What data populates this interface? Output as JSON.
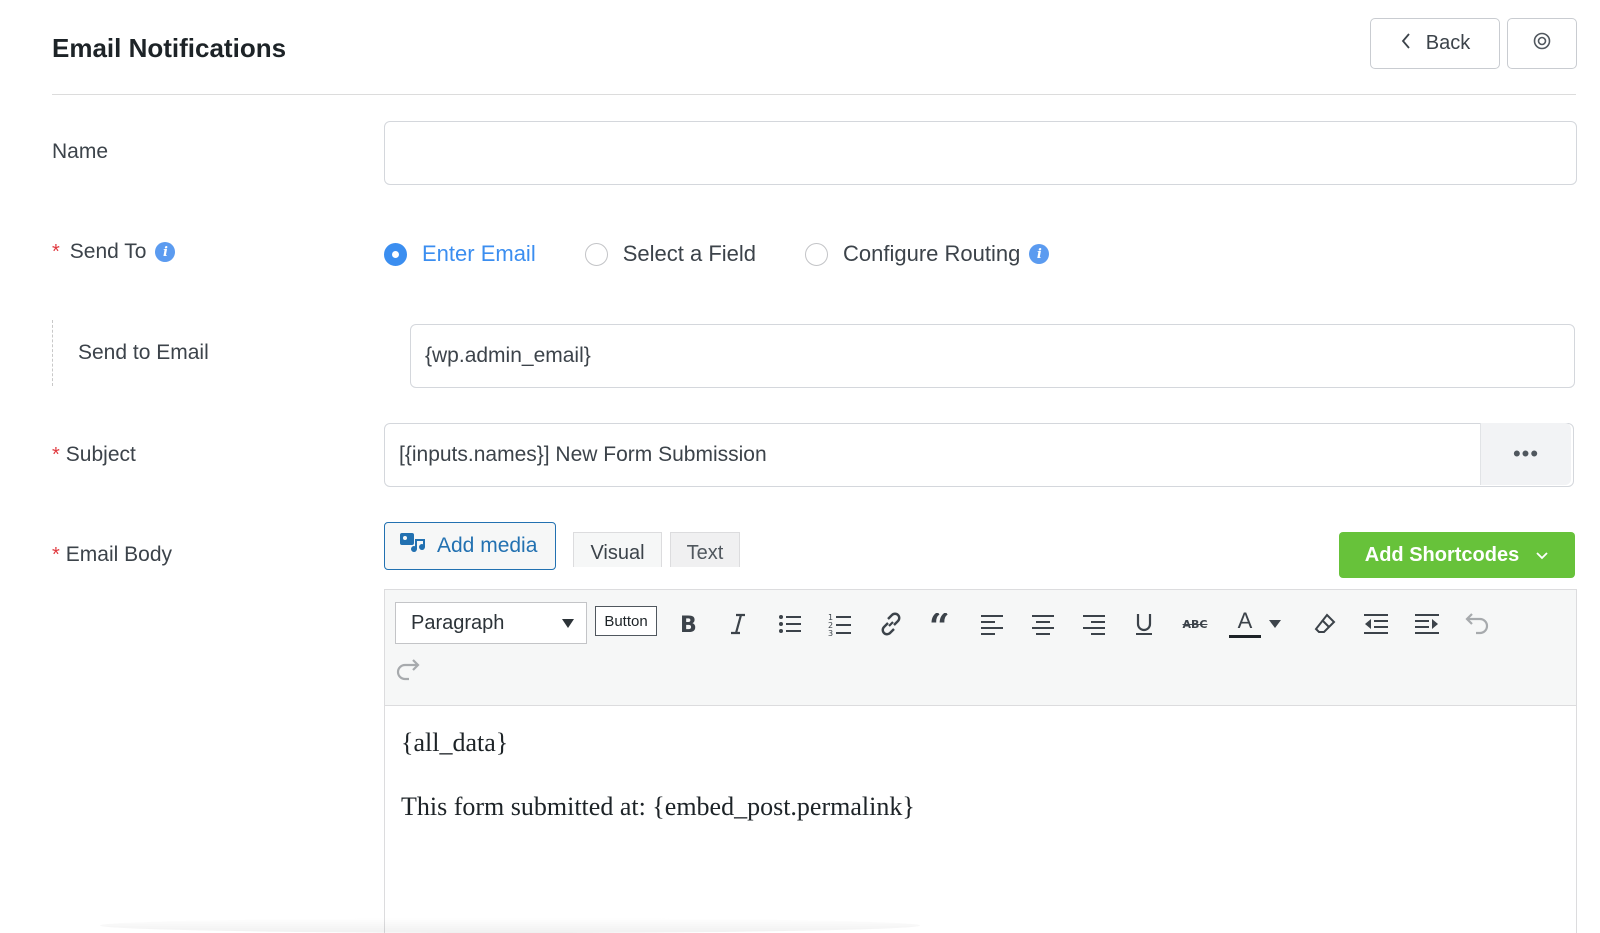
{
  "header": {
    "title": "Email Notifications",
    "back_label": "Back"
  },
  "name_field": {
    "label": "Name",
    "value": ""
  },
  "send_to": {
    "label": "Send To",
    "required_marker": "*",
    "options": [
      {
        "label": "Enter Email",
        "checked": true
      },
      {
        "label": "Select a Field",
        "checked": false
      },
      {
        "label": "Configure Routing",
        "checked": false
      }
    ]
  },
  "send_to_email": {
    "label": "Send to Email",
    "value": "{wp.admin_email}"
  },
  "subject": {
    "label": "Subject",
    "required_marker": "*",
    "value": "[{inputs.names}] New Form Submission",
    "more_label": "•••"
  },
  "email_body": {
    "label": "Email Body",
    "required_marker": "*",
    "add_media_label": "Add media",
    "tabs": [
      "Visual",
      "Text"
    ],
    "active_tab": "Visual",
    "add_shortcodes_label": "Add Shortcodes",
    "toolbar": {
      "format_value": "Paragraph",
      "button_label": "Button",
      "strikethrough_label": "ABC",
      "text_color_label": "A",
      "icons": [
        "bold-icon",
        "italic-icon",
        "bullet-list-icon",
        "numbered-list-icon",
        "link-icon",
        "blockquote-icon",
        "align-left-icon",
        "align-center-icon",
        "align-right-icon",
        "underline-icon",
        "strikethrough-icon",
        "text-color-icon",
        "clear-formatting-icon",
        "outdent-icon",
        "indent-icon",
        "undo-icon",
        "redo-icon"
      ]
    },
    "content": [
      "{all_data}",
      "This form submitted at: {embed_post.permalink}"
    ]
  },
  "colors": {
    "accent_blue": "#3b8ef0",
    "required_red": "#e0383e",
    "shortcodes_green": "#67c23a",
    "link_blue": "#2271b1"
  }
}
